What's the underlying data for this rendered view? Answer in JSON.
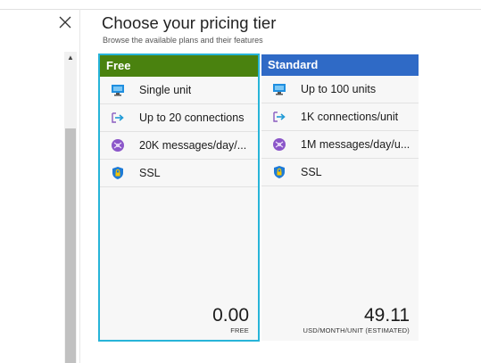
{
  "blade": {
    "title": "Choose your pricing tier",
    "subtitle": "Browse the available plans and their features"
  },
  "tiers": [
    {
      "name": "Free",
      "header_color": "#4a820f",
      "selected": true,
      "features": [
        {
          "icon": "unit-icon",
          "text": "Single unit"
        },
        {
          "icon": "connections-icon",
          "text": "Up to 20 connections"
        },
        {
          "icon": "messages-icon",
          "text": "20K messages/day/..."
        },
        {
          "icon": "ssl-icon",
          "text": "SSL"
        }
      ],
      "price": "0.00",
      "price_unit": "FREE"
    },
    {
      "name": "Standard",
      "header_color": "#2f6ac6",
      "selected": false,
      "features": [
        {
          "icon": "unit-icon",
          "text": "Up to 100 units"
        },
        {
          "icon": "connections-icon",
          "text": "1K connections/unit"
        },
        {
          "icon": "messages-icon",
          "text": "1M messages/day/u..."
        },
        {
          "icon": "ssl-icon",
          "text": "SSL"
        }
      ],
      "price": "49.11",
      "price_unit": "USD/MONTH/UNIT (ESTIMATED)"
    }
  ],
  "colors": {
    "selection_border": "#27b4d8",
    "free_header": "#4a820f",
    "standard_header": "#2f6ac6"
  }
}
